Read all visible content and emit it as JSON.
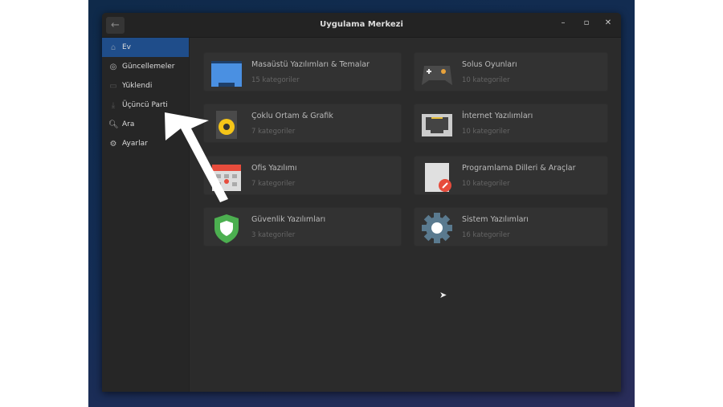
{
  "window": {
    "title": "Uygulama Merkezi",
    "back_icon": "arrow-left-icon"
  },
  "sidebar": {
    "items": [
      {
        "label": "Ev",
        "icon": "home-icon",
        "active": true
      },
      {
        "label": "Güncellemeler",
        "icon": "updates-icon"
      },
      {
        "label": "Yüklendi",
        "icon": "monitor-icon"
      },
      {
        "label": "Üçüncü Parti",
        "icon": "download-icon"
      },
      {
        "label": "Ara",
        "icon": "search-icon"
      },
      {
        "label": "Ayarlar",
        "icon": "settings-icon"
      }
    ]
  },
  "categories": [
    {
      "name": "Masaüstü Yazılımları & Temalar",
      "count": "15 kategoriler",
      "icon": "desktop-icon"
    },
    {
      "name": "Solus Oyunları",
      "count": "10 kategoriler",
      "icon": "gamepad-icon"
    },
    {
      "name": "Çoklu Ortam & Grafik",
      "count": "7 kategoriler",
      "icon": "speaker-icon"
    },
    {
      "name": "İnternet Yazılımları",
      "count": "10 kategoriler",
      "icon": "network-port-icon"
    },
    {
      "name": "Ofis Yazılımı",
      "count": "7 kategoriler",
      "icon": "calendar-icon"
    },
    {
      "name": "Programlama Dilleri & Araçlar",
      "count": "10 kategoriler",
      "icon": "text-editor-icon"
    },
    {
      "name": "Güvenlik Yazılımları",
      "count": "3 kategoriler",
      "icon": "shield-icon"
    },
    {
      "name": "Sistem Yazılımları",
      "count": "16 kategoriler",
      "icon": "gear-icon"
    }
  ]
}
